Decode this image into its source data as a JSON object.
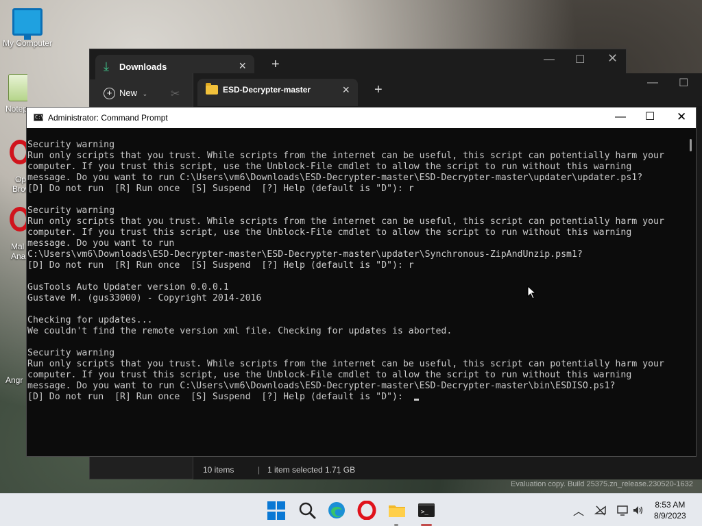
{
  "desktop": {
    "icons": [
      {
        "label": "My Computer"
      },
      {
        "label": "Notep"
      },
      {
        "label": "Op"
      },
      {
        "label": "Brow"
      },
      {
        "label": "Mal"
      },
      {
        "label": "Ana"
      },
      {
        "label": "Angr"
      }
    ],
    "watermark": "Evaluation copy. Build 25375.zn_release.230520-1632"
  },
  "explorer_back": {
    "tab_title": "Downloads",
    "new_label": "New"
  },
  "explorer_front": {
    "tab_title": "ESD-Decrypter-master",
    "status": {
      "items": "10 items",
      "selected": "1 item selected 1.71 GB"
    }
  },
  "cmd": {
    "title": "Administrator: Command Prompt",
    "lines": [
      "Security warning",
      "Run only scripts that you trust. While scripts from the internet can be useful, this script can potentially harm your",
      "computer. If you trust this script, use the Unblock-File cmdlet to allow the script to run without this warning",
      "message. Do you want to run C:\\Users\\vm6\\Downloads\\ESD-Decrypter-master\\ESD-Decrypter-master\\updater\\updater.ps1?",
      "[D] Do not run  [R] Run once  [S] Suspend  [?] Help (default is \"D\"): r",
      "",
      "Security warning",
      "Run only scripts that you trust. While scripts from the internet can be useful, this script can potentially harm your",
      "computer. If you trust this script, use the Unblock-File cmdlet to allow the script to run without this warning",
      "message. Do you want to run",
      "C:\\Users\\vm6\\Downloads\\ESD-Decrypter-master\\ESD-Decrypter-master\\updater\\Synchronous-ZipAndUnzip.psm1?",
      "[D] Do not run  [R] Run once  [S] Suspend  [?] Help (default is \"D\"): r",
      "",
      "GusTools Auto Updater version 0.0.0.1",
      "Gustave M. (gus33000) - Copyright 2014-2016",
      "",
      "Checking for updates...",
      "We couldn't find the remote version xml file. Checking for updates is aborted.",
      "",
      "Security warning",
      "Run only scripts that you trust. While scripts from the internet can be useful, this script can potentially harm your",
      "computer. If you trust this script, use the Unblock-File cmdlet to allow the script to run without this warning",
      "message. Do you want to run C:\\Users\\vm6\\Downloads\\ESD-Decrypter-master\\ESD-Decrypter-master\\bin\\ESDISO.ps1?",
      "[D] Do not run  [R] Run once  [S] Suspend  [?] Help (default is \"D\"): "
    ]
  },
  "taskbar": {
    "apps": [
      "start-icon",
      "search-icon",
      "edge-icon",
      "opera-icon",
      "file-explorer-icon",
      "terminal-icon"
    ],
    "clock": {
      "time": "8:53 AM",
      "date": "8/9/2023"
    }
  },
  "colors": {
    "console_bg": "#0c0c0c",
    "console_fg": "#cccccc",
    "accent": "#0a78d4"
  }
}
